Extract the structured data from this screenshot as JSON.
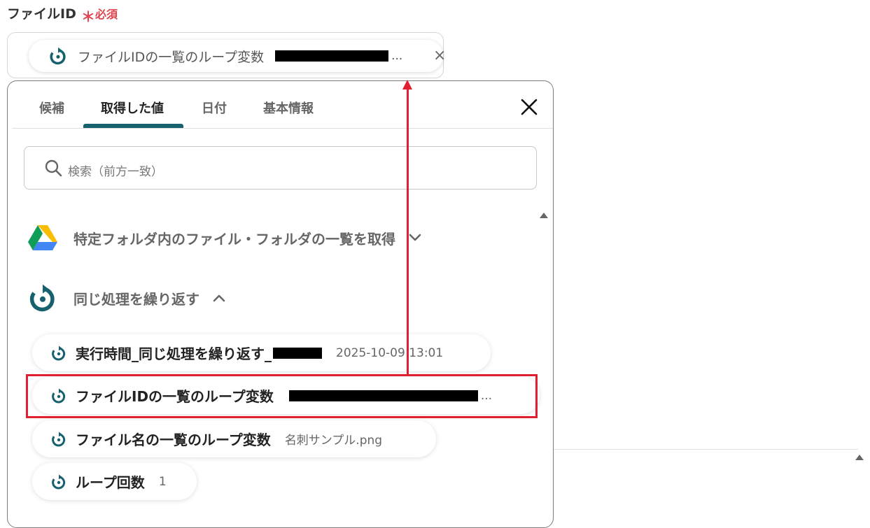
{
  "field": {
    "label": "ファイルID",
    "required_mark": "＊",
    "required_text": "必須",
    "chip_label": "ファイルIDの一覧のループ変数",
    "chip_ellipsis": "...",
    "chip_remove": "×"
  },
  "panel": {
    "tabs": [
      {
        "label": "候補",
        "active": false
      },
      {
        "label": "取得した値",
        "active": true
      },
      {
        "label": "日付",
        "active": false
      },
      {
        "label": "基本情報",
        "active": false
      }
    ],
    "search_placeholder": "検索（前方一致）",
    "groups": [
      {
        "label": "特定フォルダ内のファイル・フォルダの一覧を取得",
        "icon": "google-drive-icon",
        "expanded": false
      },
      {
        "label": "同じ処理を繰り返す",
        "icon": "loop-icon",
        "expanded": true
      }
    ],
    "items": [
      {
        "label": "実行時間_同じ処理を繰り返す_",
        "value": "2025-10-09 13:01"
      },
      {
        "label": "ファイルIDの一覧のループ変数",
        "value": "..."
      },
      {
        "label": "ファイル名の一覧のループ変数",
        "value": "名刺サンプル.png"
      },
      {
        "label": "ループ回数",
        "value": "1"
      }
    ]
  },
  "colors": {
    "accent": "#17616f",
    "required": "#e0424e",
    "annotation": "#e02030"
  }
}
